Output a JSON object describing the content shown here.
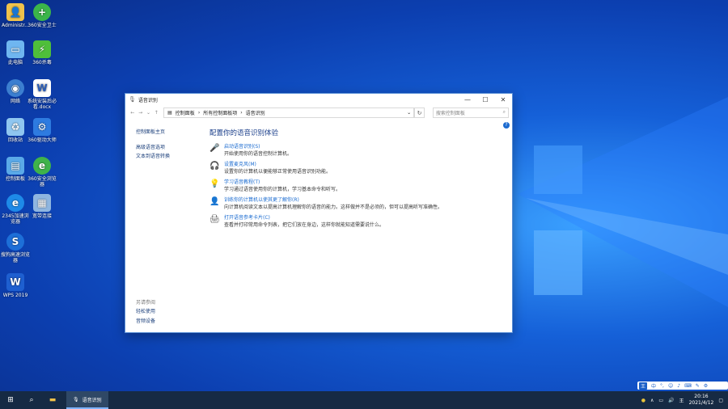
{
  "desktop": {
    "icons": [
      {
        "label": "Administr...",
        "icon": "user-folder-icon"
      },
      {
        "label": "360安全卫士",
        "icon": "360-safe-icon"
      },
      {
        "label": "此电脑",
        "icon": "computer-icon"
      },
      {
        "label": "360杀毒",
        "icon": "360-antivirus-icon"
      },
      {
        "label": "网络",
        "icon": "network-icon"
      },
      {
        "label": "系统安装后必看.docx",
        "icon": "word-doc-icon"
      },
      {
        "label": "回收站",
        "icon": "recycle-bin-icon"
      },
      {
        "label": "360驱动大师",
        "icon": "360-driver-icon"
      },
      {
        "label": "控制面板",
        "icon": "control-panel-icon"
      },
      {
        "label": "360安全浏览器",
        "icon": "360-browser-icon"
      },
      {
        "label": "2345加速浏览器",
        "icon": "2345-browser-icon"
      },
      {
        "label": "宽带连接",
        "icon": "broadband-icon"
      },
      {
        "label": "搜狗高速浏览器",
        "icon": "sogou-browser-icon"
      },
      {
        "label": "WPS 2019",
        "icon": "wps-icon"
      }
    ]
  },
  "window": {
    "title": "语音识别",
    "minimize": "—",
    "maximize": "☐",
    "close": "✕",
    "breadcrumb": [
      "控制面板",
      "所有控制面板项",
      "语音识别"
    ],
    "search_placeholder": "搜索控制面板",
    "left_links": [
      "控制面板主页",
      "高级语音选项",
      "文本到语音转换"
    ],
    "see_also_label": "另请参阅",
    "see_also": [
      "轻松使用",
      "音频设备"
    ],
    "heading": "配置你的语音识别体验",
    "items": [
      {
        "link": "启动语音识别(S)",
        "desc": "开始使用你的语音控制计算机。",
        "icon": "microphone-icon"
      },
      {
        "link": "设置麦克风(M)",
        "desc": "设置你的计算机以便能够正常使用语音识别功能。",
        "icon": "headset-icon"
      },
      {
        "link": "学习语音教程(T)",
        "desc": "学习通过语音使用你的计算机，学习基本命令和听写。",
        "icon": "lightbulb-icon"
      },
      {
        "link": "训练你的计算机以使其更了解你(R)",
        "desc": "向计算机阅读文本以提高计算机理解你的语音的能力。这样做并不是必须的，但可以提高听写准确性。",
        "icon": "user-voice-icon"
      },
      {
        "link": "打开语音参考卡片(C)",
        "desc": "查看并打印常用命令列表，把它们放在身边，这样你就能知道需要说什么。",
        "icon": "printer-icon"
      }
    ]
  },
  "taskbar": {
    "app_label": "语音识别",
    "time": "20:16",
    "date": "2021/4/12"
  },
  "ime": {
    "mode": "中"
  }
}
